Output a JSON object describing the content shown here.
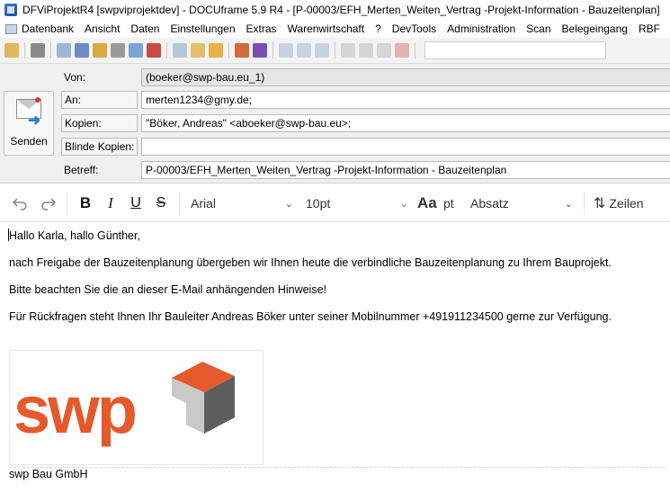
{
  "window": {
    "title": "DFViProjektR4 [swpviprojektdev] - DOCUframe 5.9 R4 - [P-00003/EFH_Merten_Weiten_Vertrag -Projekt-Information - Bauzeitenplan]"
  },
  "menu": [
    "Datenbank",
    "Ansicht",
    "Daten",
    "Einstellungen",
    "Extras",
    "Warenwirtschaft",
    "?",
    "DevTools",
    "Administration",
    "Scan",
    "Belegeingang",
    "RBF"
  ],
  "header": {
    "send_label": "Senden",
    "from_label": "Von:",
    "from_value": "(boeker@swp-bau.eu_1)",
    "to_label": "An:",
    "to_value": "merten1234@gmy.de;",
    "cc_label": "Kopien:",
    "cc_value": "\"Böker, Andreas\" <aboeker@swp-bau.eu>;",
    "bcc_label": "Blinde Kopien:",
    "bcc_value": "",
    "subject_label": "Betreff:",
    "subject_value": "P-00003/EFH_Merten_Weiten_Vertrag -Projekt-Information - Bauzeitenplan"
  },
  "editor_toolbar": {
    "bold": "B",
    "italic": "I",
    "underline": "U",
    "strike": "S",
    "font": "Arial",
    "size": "10pt",
    "case_glyph": "Aa",
    "unit": "pt",
    "paragraph": "Absatz",
    "line_spacing": "Zeilen"
  },
  "body": {
    "greeting": "Hallo Karla, hallo Günther,",
    "line1": "nach Freigabe der Bauzeitenplanung übergeben wir Ihnen heute die verbindliche Bauzeitenplanung zu Ihrem Bauprojekt.",
    "line2": "Bitte beachten Sie die an dieser E-Mail anhängenden Hinweise!",
    "line3": "Für Rückfragen steht Ihnen Ihr Bauleiter Andreas Böker unter seiner Mobilnummer +491911234500 gerne zur Verfügung.",
    "logo_text": "swp",
    "company": "swp Bau GmbH"
  },
  "colors": {
    "brand_orange": "#e55a2b",
    "cube_dark": "#5e5e5e",
    "cube_light": "#bdbdbd"
  }
}
